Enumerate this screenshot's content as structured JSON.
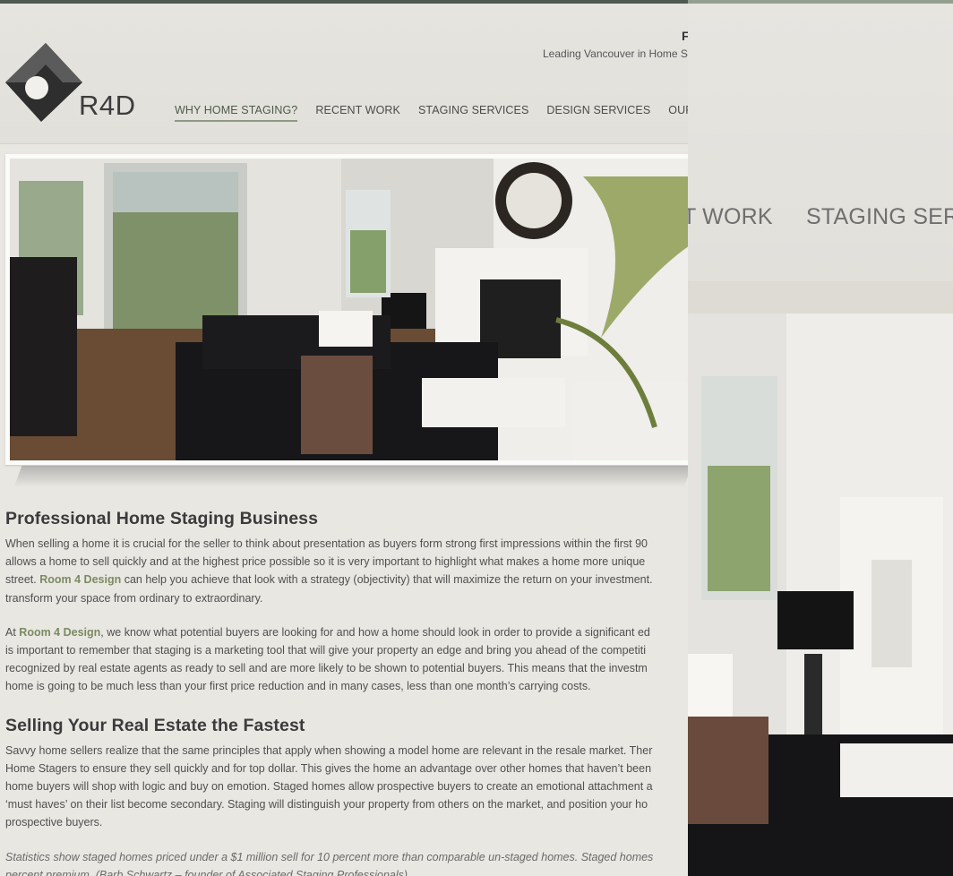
{
  "header": {
    "logo_text": "R4D",
    "phone": "F",
    "tagline": "Leading Vancouver in Home S"
  },
  "nav": {
    "items": [
      {
        "label": "WHY HOME STAGING?"
      },
      {
        "label": "RECENT WORK"
      },
      {
        "label": "STAGING SERVICES"
      },
      {
        "label": "DESIGN SERVICES"
      },
      {
        "label": "OUR INSPI"
      }
    ]
  },
  "content": {
    "heading1": "Professional Home Staging Business",
    "p1_lines": [
      "When selling a home it is crucial for the seller to think about presentation as buyers form strong first impressions within the first 90",
      "allows a home to sell quickly and at the highest price possible so it is very important to highlight what makes a home more unique",
      "street.",
      "Room 4 Design",
      "can help you achieve that look with a strategy (objectivity) that will maximize the return on your investment.",
      "transform your space from ordinary to extraordinary."
    ],
    "p2_lines": [
      "At",
      "Room 4 Design",
      ", we know what potential buyers are looking for and how a home should look in order to provide a significant ed",
      "is important to remember that staging is a marketing tool that will give your property an edge and bring you ahead of the competiti",
      "recognized by real estate agents as ready to sell and are more likely to be shown to potential buyers. This means that the investm",
      "home is going to be much less than your first price reduction and in many cases, less than one month’s carrying costs."
    ],
    "heading2": "Selling Your Real Estate the Fastest",
    "p3_lines": [
      "Savvy home sellers realize that the same principles that apply when showing a model home are relevant in the resale market. Ther",
      "Home Stagers to ensure they sell quickly and for top dollar. This gives the home an advantage over other homes that haven’t been",
      "home buyers will shop with logic and buy on emotion. Staged homes allow prospective buyers to create an emotional attachment a",
      "‘must haves’ on their list become secondary. Staging will distinguish your property from others on the market, and position your ho",
      "prospective buyers."
    ],
    "p4_lines": [
      "Statistics show staged homes priced under a $1 million sell for 10 percent more than comparable un-staged homes. Staged homes",
      "percent premium. (Barb Schwartz – founder of Associated Staging Professionals)."
    ]
  },
  "zoom": {
    "nav_a": "T WORK",
    "nav_b": "STAGING SERV"
  },
  "colors": {
    "accent": "#7b8a62",
    "topbar": "#4e5a4f"
  }
}
